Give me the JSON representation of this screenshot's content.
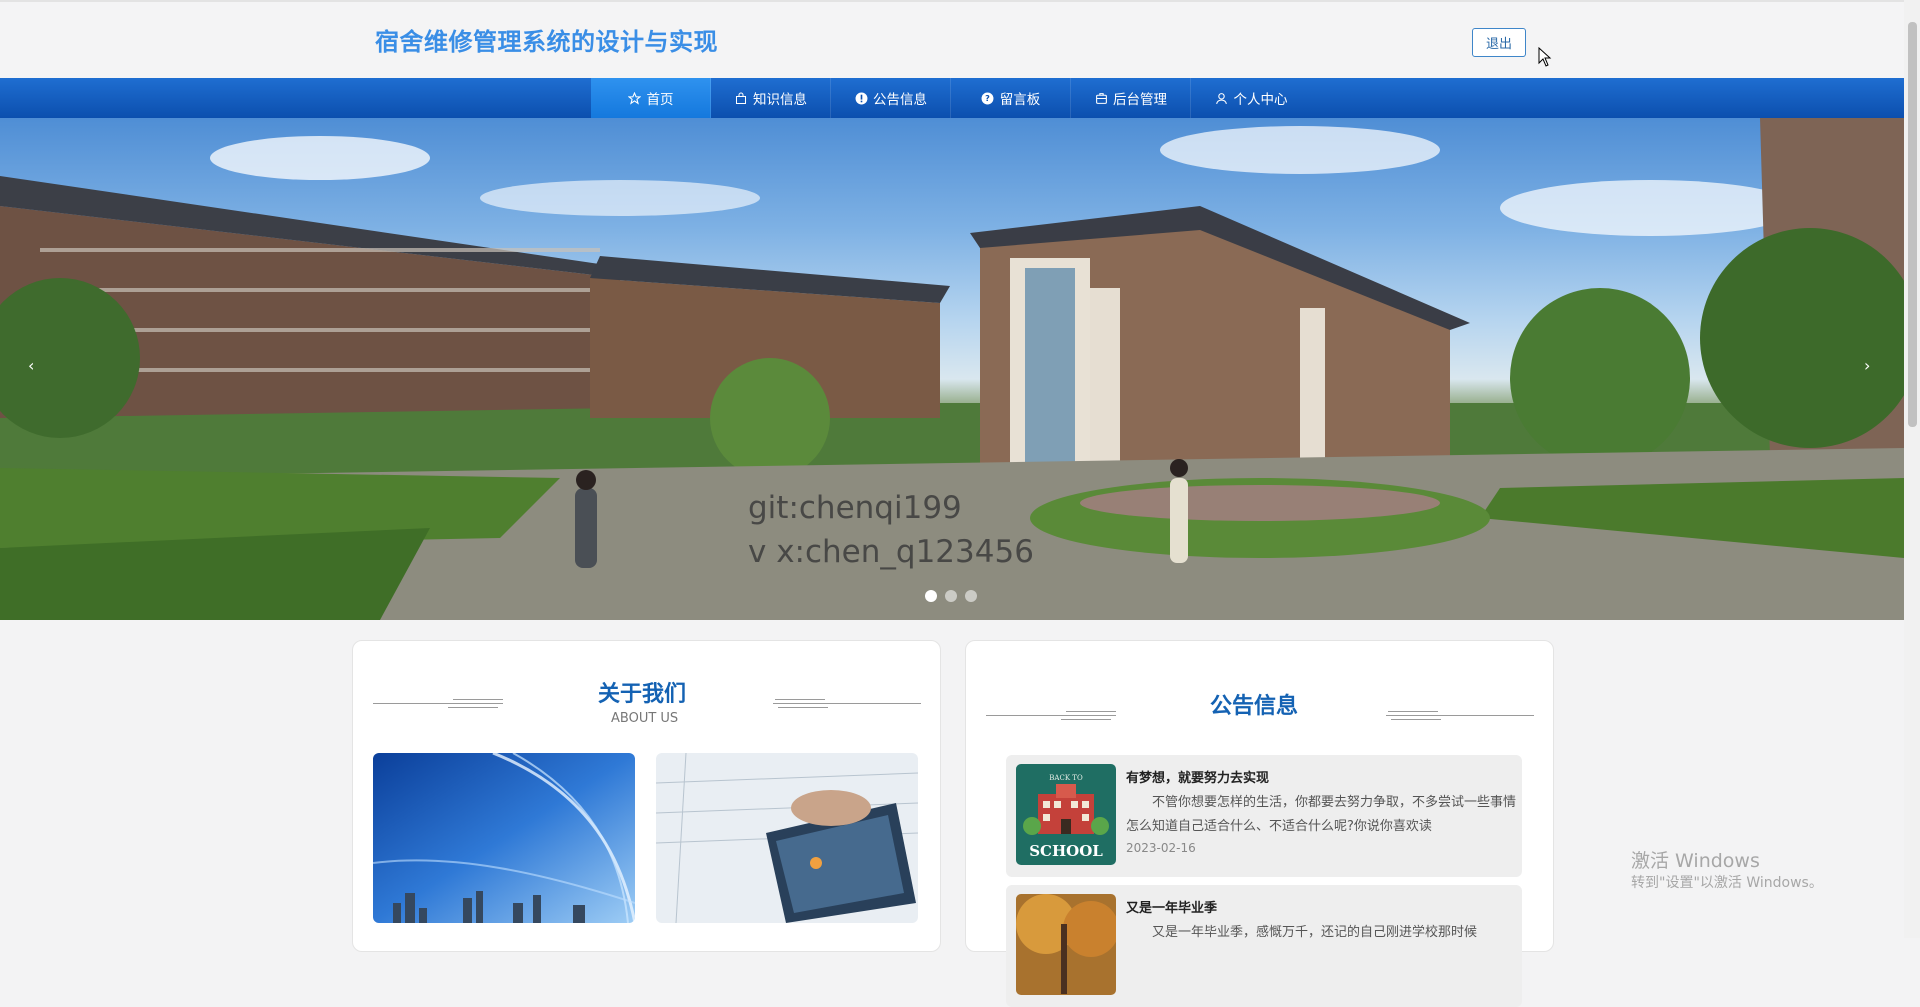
{
  "header": {
    "site_title": "宿舍维修管理系统的设计与实现",
    "logout_label": "退出"
  },
  "nav": {
    "items": [
      {
        "label": "首页",
        "icon": "star-icon",
        "active": true
      },
      {
        "label": "知识信息",
        "icon": "bag-icon"
      },
      {
        "label": "公告信息",
        "icon": "info-icon"
      },
      {
        "label": "留言板",
        "icon": "question-icon"
      },
      {
        "label": "后台管理",
        "icon": "briefcase-icon"
      },
      {
        "label": "个人中心",
        "icon": "user-icon"
      }
    ]
  },
  "banner": {
    "watermark_line1": "git:chenqi199",
    "watermark_line2": "v x:chen_q123456",
    "prev_label": "‹",
    "next_label": "›",
    "slide_count": 3,
    "active_slide": 1
  },
  "about": {
    "title": "关于我们",
    "subtitle": "ABOUT US"
  },
  "notice": {
    "title": "公告信息",
    "items": [
      {
        "title": "有梦想，就要努力去实现",
        "text": "不管你想要怎样的生活，你都要去努力争取，不多尝试一些事情怎么知道自己适合什么、不适合什么呢?你说你喜欢读",
        "date": "2023-02-16",
        "thumb_text_top": "BACK TO",
        "thumb_text_main": "SCHOOL"
      },
      {
        "title": "又是一年毕业季",
        "text": "又是一年毕业季，感慨万千，还记的自己刚进学校那时候",
        "date": ""
      }
    ]
  },
  "os_watermark": {
    "line1": "激活 Windows",
    "line2": "转到\"设置\"以激活 Windows。"
  },
  "colors": {
    "title_blue": "#3a8ee6",
    "nav_blue": "#0c4fae",
    "nav_active": "#1478dd",
    "section_title": "#1462b3"
  }
}
